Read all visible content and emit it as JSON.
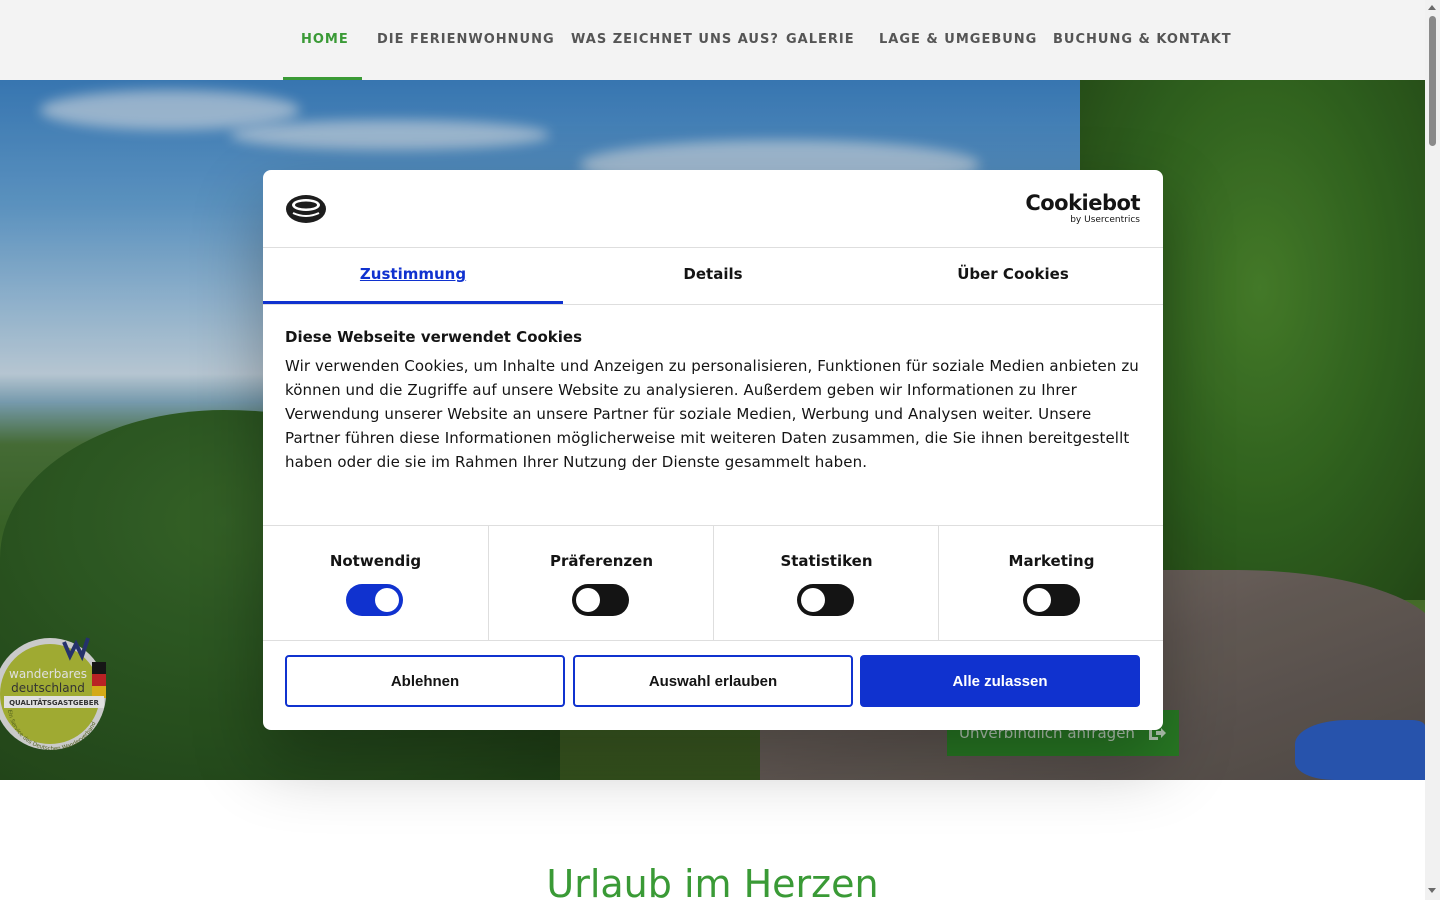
{
  "nav": {
    "items": [
      {
        "label": "HOME",
        "active": true
      },
      {
        "label": "DIE FERIENWOHNUNG",
        "active": false
      },
      {
        "label": "WAS ZEICHNET UNS AUS?",
        "active": false
      },
      {
        "label": "GALERIE",
        "active": false
      },
      {
        "label": "LAGE & UMGEBUNG",
        "active": false
      },
      {
        "label": "BUCHUNG & KONTAKT",
        "active": false
      }
    ]
  },
  "hero": {
    "cta_label": "Unverbindlich anfragen",
    "badge": {
      "line1": "wanderbares",
      "line2": "deutschland",
      "line3": "QUALITÄTSGASTGEBER",
      "arc_text": "Ein Service des Deutschen Wanderverbandes"
    }
  },
  "section": {
    "heading": "Urlaub im Herzen"
  },
  "cookie_dialog": {
    "brand": {
      "name": "Cookiebot",
      "sub": "by Usercentrics"
    },
    "tabs": [
      {
        "label": "Zustimmung",
        "active": true
      },
      {
        "label": "Details",
        "active": false
      },
      {
        "label": "Über Cookies",
        "active": false
      }
    ],
    "title": "Diese Webseite verwendet Cookies",
    "body": "Wir verwenden Cookies, um Inhalte und Anzeigen zu personalisieren, Funktionen für soziale Medien anbieten zu können und die Zugriffe auf unsere Website zu analysieren. Außerdem geben wir Informationen zu Ihrer Verwendung unserer Website an unsere Partner für soziale Medien, Werbung und Analysen weiter. Unsere Partner führen diese Informationen möglicherweise mit weiteren Daten zusammen, die Sie ihnen bereitgestellt haben oder die sie im Rahmen Ihrer Nutzung der Dienste gesammelt haben.",
    "categories": [
      {
        "label": "Notwendig",
        "enabled": true
      },
      {
        "label": "Präferenzen",
        "enabled": false
      },
      {
        "label": "Statistiken",
        "enabled": false
      },
      {
        "label": "Marketing",
        "enabled": false
      }
    ],
    "buttons": {
      "decline": "Ablehnen",
      "allow_selection": "Auswahl erlauben",
      "allow_all": "Alle zulassen"
    }
  },
  "colors": {
    "accent_green": "#3a9a36",
    "cookiebot_blue": "#1032cf",
    "cta_green": "#2e8b2a"
  }
}
